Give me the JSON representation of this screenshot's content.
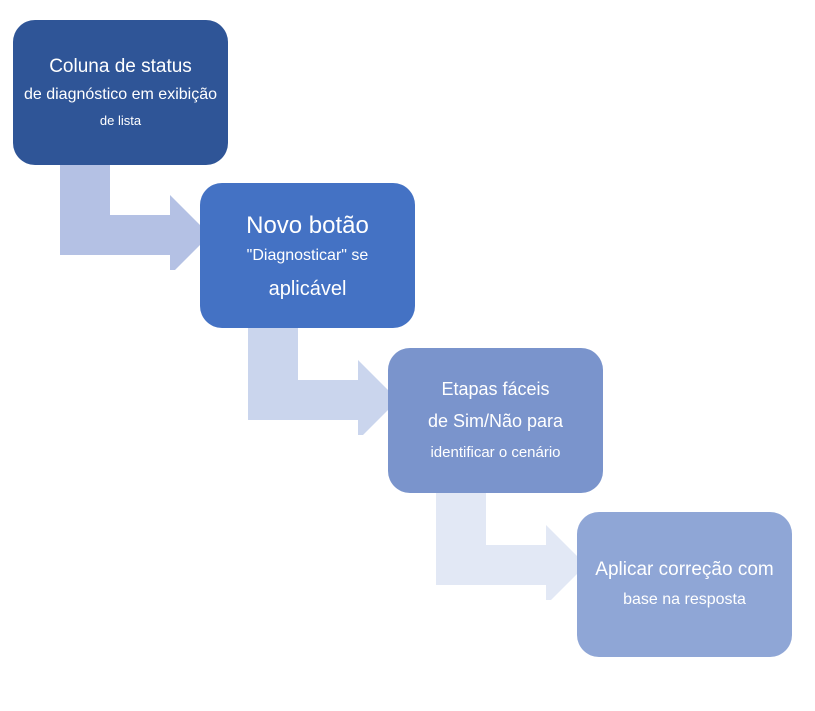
{
  "diagram": {
    "type": "process-flow",
    "direction": "diagonal-step-down",
    "steps": [
      {
        "id": "step1",
        "color": "#2f5597",
        "line1": "Coluna de status",
        "line2": "de diagnóstico em exibição",
        "line3": "de lista"
      },
      {
        "id": "step2",
        "color": "#4472c4",
        "line1": "Novo botão",
        "line2": "\"Diagnosticar\" se",
        "line3": "aplicável"
      },
      {
        "id": "step3",
        "color": "#7a94cc",
        "line1": "Etapas fáceis",
        "line2": "de Sim/Não para",
        "line3": "identificar o cenário"
      },
      {
        "id": "step4",
        "color": "#8fa6d6",
        "line1": "Aplicar correção com",
        "line2": "base na resposta",
        "line3": ""
      }
    ],
    "arrows": [
      {
        "id": "arrow1",
        "color": "#b4c1e4"
      },
      {
        "id": "arrow2",
        "color": "#cad5ed"
      },
      {
        "id": "arrow3",
        "color": "#e2e8f5"
      }
    ]
  }
}
